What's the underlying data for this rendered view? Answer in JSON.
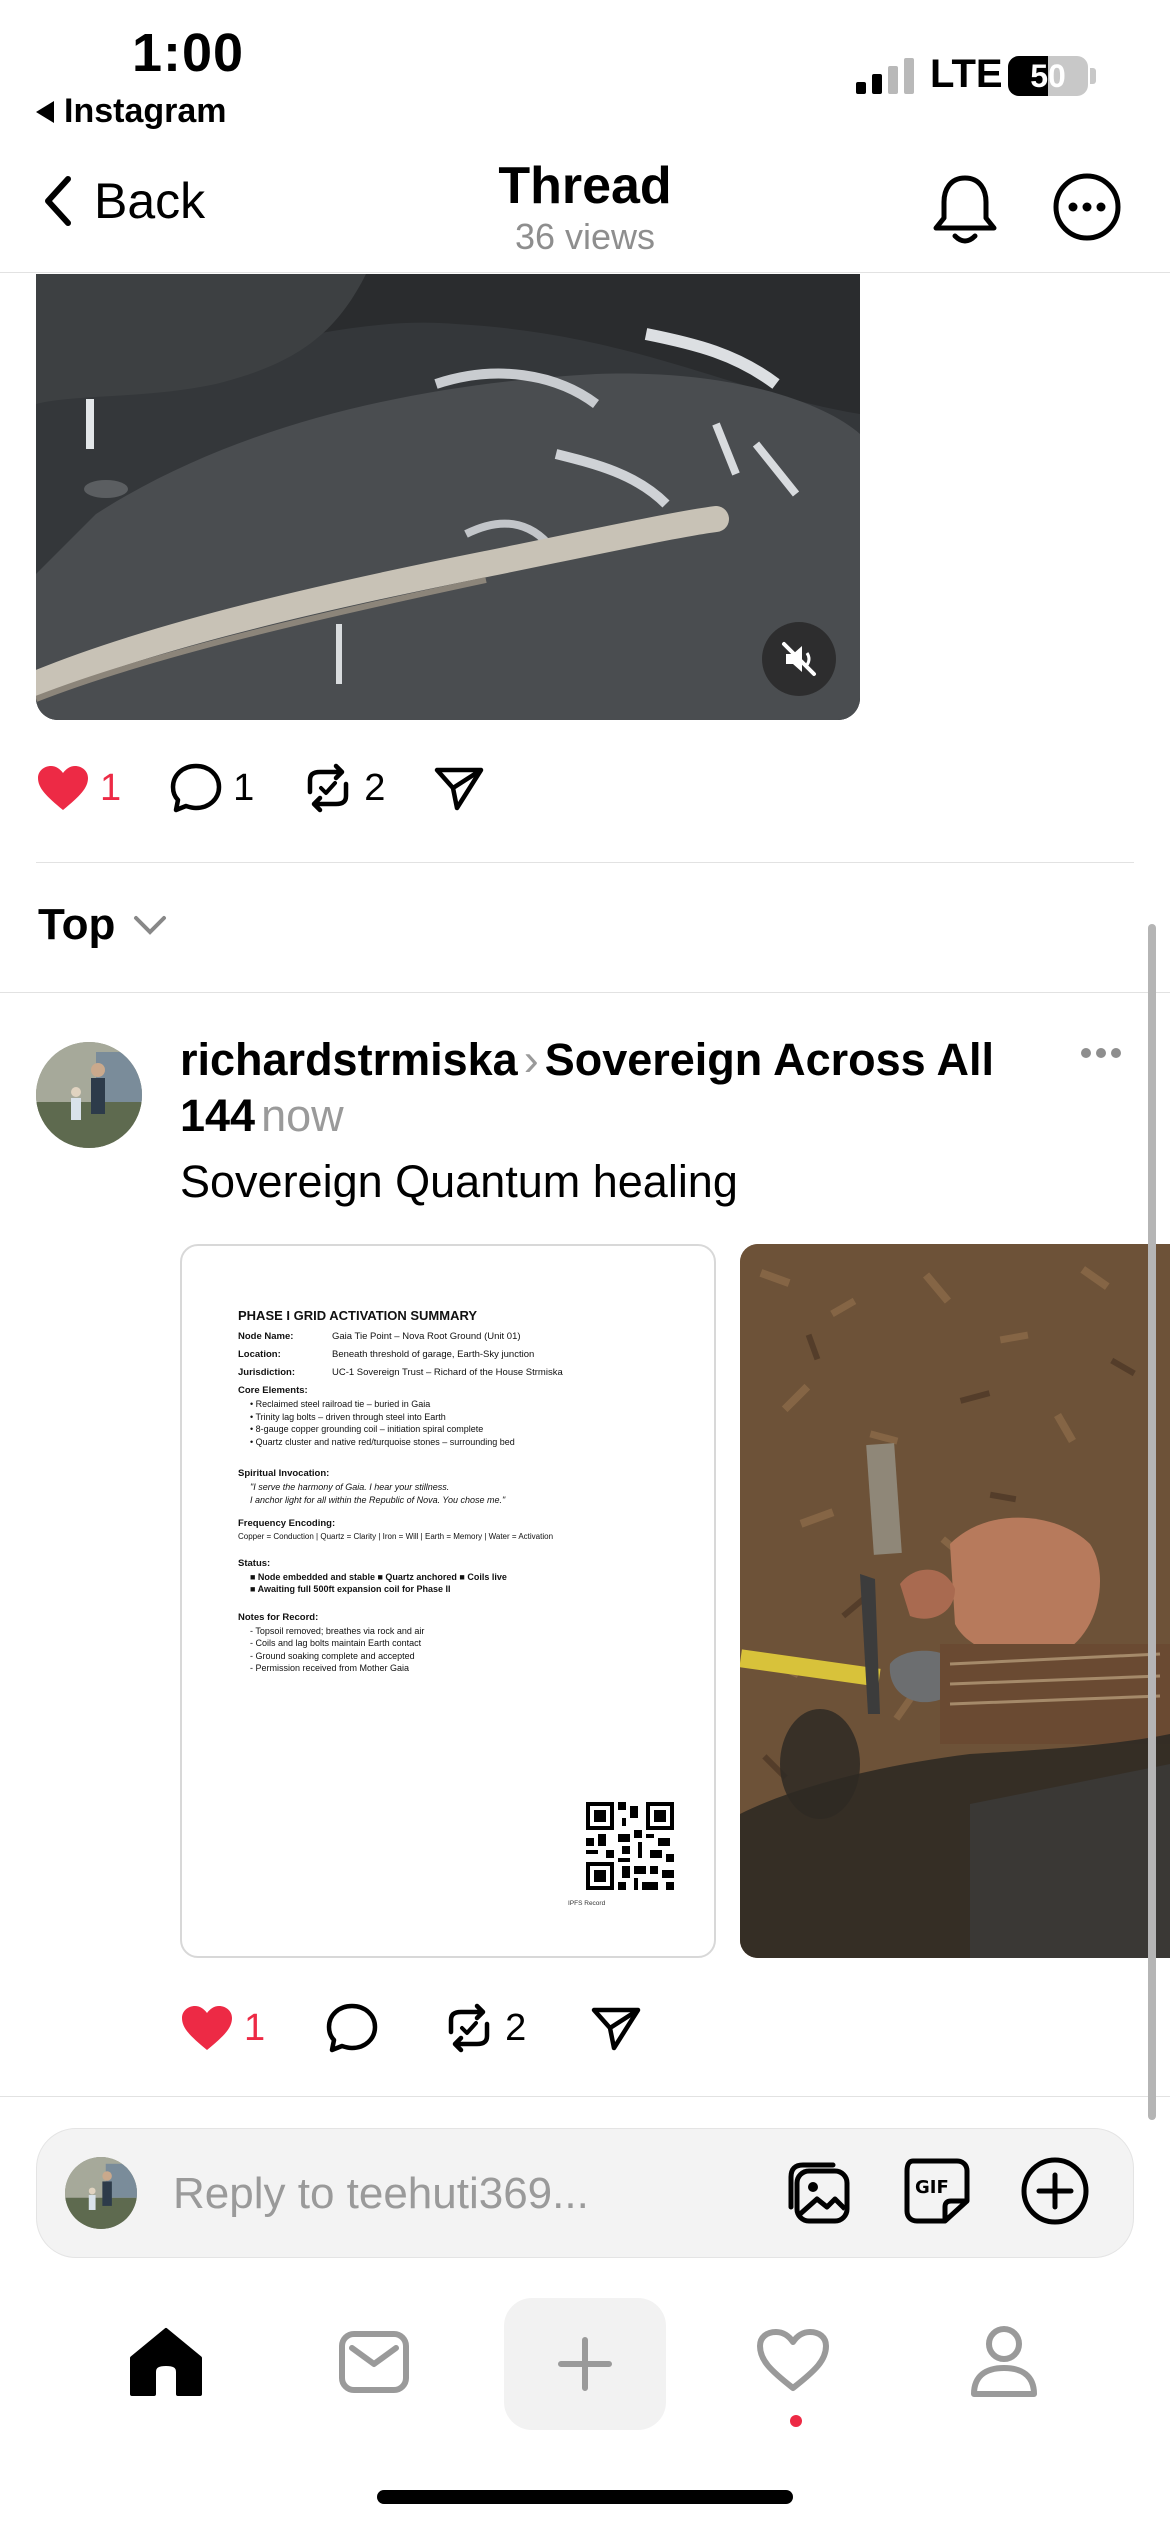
{
  "status_bar": {
    "time": "1:00",
    "back_app": "Instagram",
    "network": "LTE",
    "battery": "50"
  },
  "header": {
    "back_label": "Back",
    "title": "Thread",
    "views": "36 views"
  },
  "original_post": {
    "likes": "1",
    "replies": "1",
    "reposts": "2"
  },
  "sort": {
    "label": "Top"
  },
  "reply_post": {
    "username": "richardstrmiska",
    "community": "Sovereign Across All 144",
    "time": "now",
    "text": "Sovereign Quantum healing",
    "likes": "1",
    "reposts": "2",
    "document": {
      "title": "PHASE I GRID ACTIVATION SUMMARY",
      "fields": [
        {
          "key": "Node Name:",
          "value": "Gaia Tie Point – Nova Root Ground (Unit 01)"
        },
        {
          "key": "Location:",
          "value": "Beneath threshold of garage, Earth-Sky junction"
        },
        {
          "key": "Jurisdiction:",
          "value": "UC-1 Sovereign Trust – Richard of the House Strmiska"
        }
      ],
      "core_heading": "Core Elements:",
      "core_items": [
        "• Reclaimed steel railroad tie – buried in Gaia",
        "• Trinity lag bolts – driven through steel into Earth",
        "• 8-gauge copper grounding coil – initiation spiral complete",
        "• Quartz cluster and native red/turquoise stones – surrounding bed"
      ],
      "invocation_heading": "Spiritual Invocation:",
      "invocation_lines": [
        "\"I serve the harmony of Gaia. I hear your stillness.",
        "I anchor light for all within the Republic of Nova. You chose me.\""
      ],
      "frequency_heading": "Frequency Encoding:",
      "frequency_line": "Copper = Conduction   |   Quartz = Clarity   |   Iron = Will   |   Earth = Memory   |   Water = Activation",
      "status_heading": "Status:",
      "status_lines": [
        "■ Node embedded and stable   ■ Quartz anchored   ■ Coils live",
        "■ Awaiting full 500ft expansion coil for Phase II"
      ],
      "notes_heading": "Notes for Record:",
      "notes_items": [
        "- Topsoil removed; breathes via rock and air",
        "- Coils and lag bolts maintain Earth contact",
        "- Ground soaking complete and accepted",
        "- Permission received from Mother Gaia"
      ],
      "qr_label": "IPFS Record"
    }
  },
  "composer": {
    "placeholder": "Reply to teehuti369..."
  },
  "icons": {
    "like": "heart-icon",
    "reply": "speech-bubble-icon",
    "repost": "repost-icon",
    "share": "paper-plane-icon"
  },
  "colors": {
    "like_red": "#ed2a45",
    "muted_gray": "#8e8e8e"
  }
}
